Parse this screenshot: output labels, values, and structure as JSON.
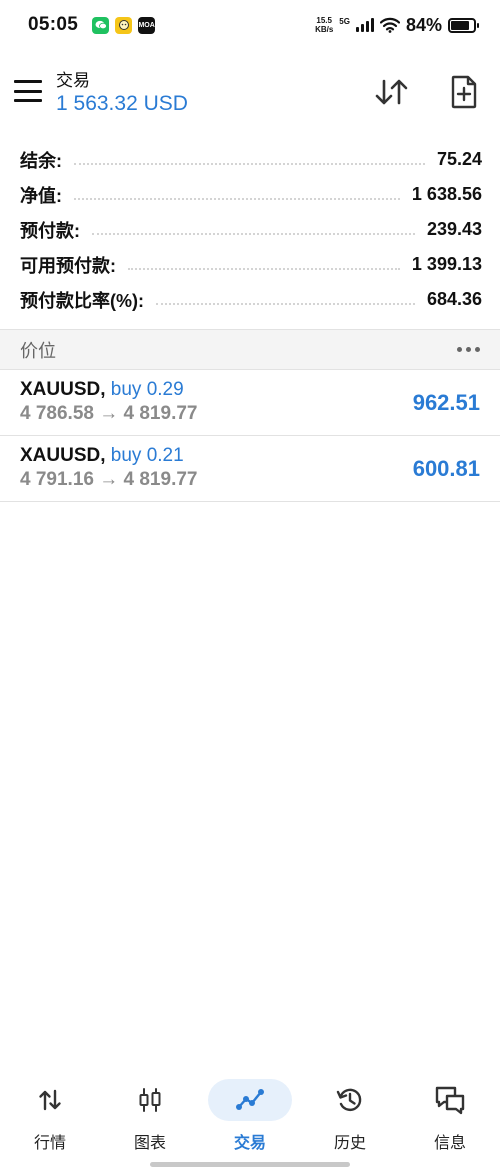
{
  "status_bar": {
    "time": "05:05",
    "net_speed_value": "15.5",
    "net_speed_unit": "KB/s",
    "network": "5G",
    "battery": "84%",
    "battery_level": 0.84,
    "apps": [
      {
        "icon": "wechat-icon"
      },
      {
        "icon": "yellow-app-icon"
      },
      {
        "icon": "moa-app-icon",
        "label": "MOA"
      }
    ]
  },
  "header": {
    "title": "交易",
    "balance": "1 563.32 USD"
  },
  "summary": [
    {
      "label": "结余:",
      "value": "75.24"
    },
    {
      "label": "净值:",
      "value": "1 638.56"
    },
    {
      "label": "预付款:",
      "value": "239.43"
    },
    {
      "label": "可用预付款:",
      "value": "1 399.13"
    },
    {
      "label": "预付款比率(%):",
      "value": "684.36"
    }
  ],
  "positions_section": {
    "title": "价位"
  },
  "positions": [
    {
      "symbol": "XAUUSD",
      "comma": ",",
      "side": "buy 0.29",
      "prices": "4 786.58 → 4 819.77",
      "profit": "962.51"
    },
    {
      "symbol": "XAUUSD",
      "comma": ",",
      "side": "buy 0.21",
      "prices": "4 791.16 → 4 819.77",
      "profit": "600.81"
    }
  ],
  "nav": [
    {
      "label": "行情",
      "icon": "quotes-icon",
      "active": false
    },
    {
      "label": "图表",
      "icon": "chart-candles-icon",
      "active": false
    },
    {
      "label": "交易",
      "icon": "trade-icon",
      "active": true
    },
    {
      "label": "历史",
      "icon": "history-icon",
      "active": false
    },
    {
      "label": "信息",
      "icon": "messages-icon",
      "active": false
    }
  ],
  "colors": {
    "accent": "#2a7bd4",
    "active_nav_bg": "#e6f0fb",
    "wechat": "#1fc160"
  }
}
